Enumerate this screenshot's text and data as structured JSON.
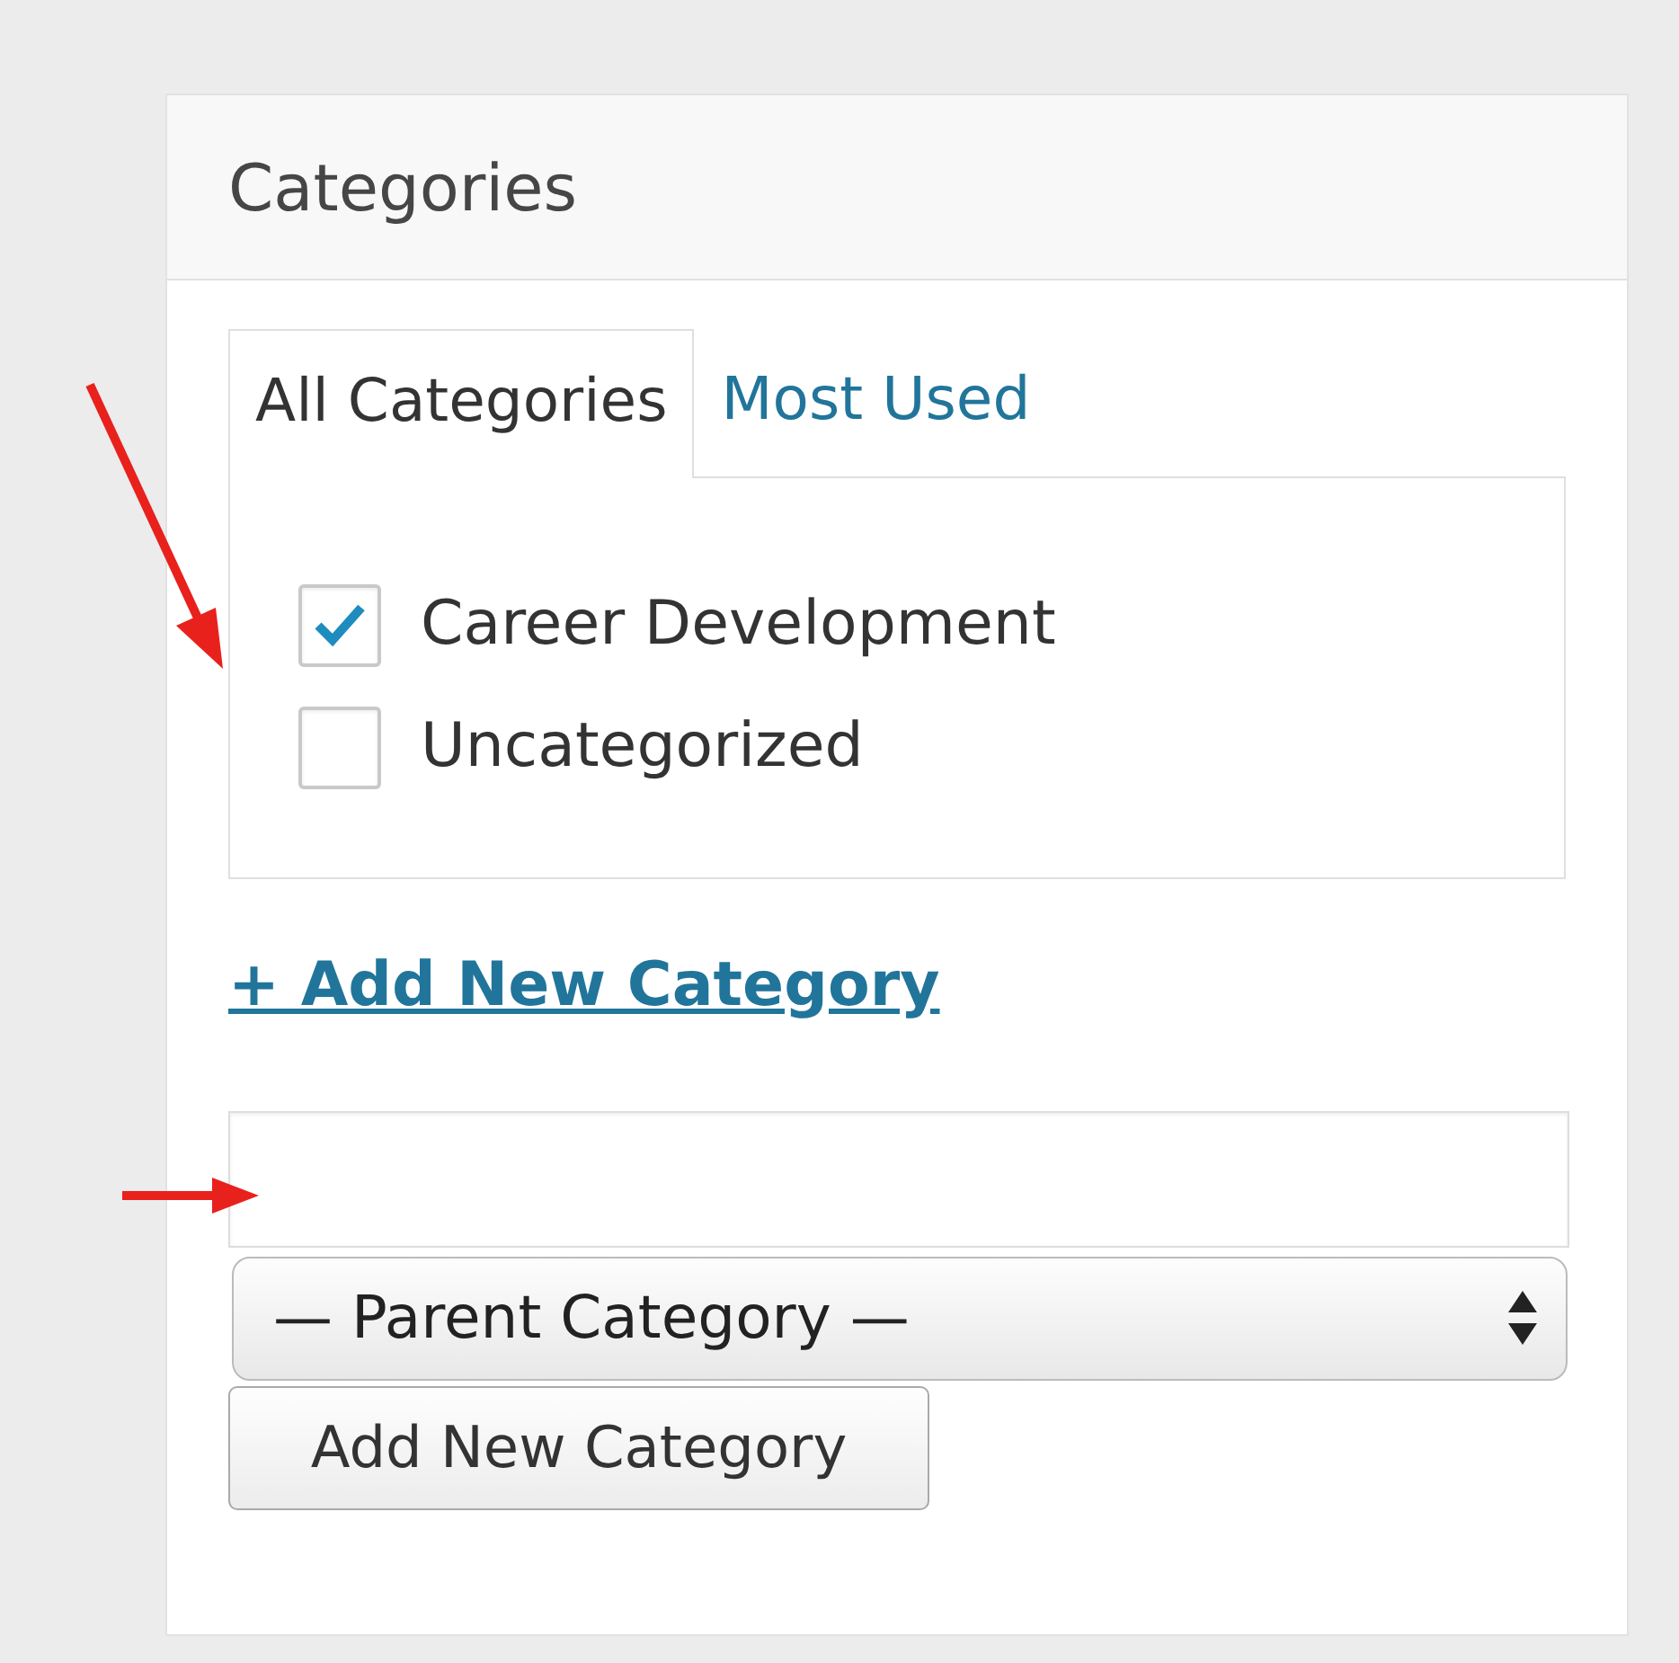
{
  "panel": {
    "title": "Categories"
  },
  "tabs": [
    {
      "label": "All Categories",
      "selected": true
    },
    {
      "label": "Most Used",
      "selected": false
    }
  ],
  "categories": [
    {
      "label": "Career Development",
      "checked": true
    },
    {
      "label": "Uncategorized",
      "checked": false
    }
  ],
  "add_link": "+ Add New Category",
  "parent_select": {
    "value": "— Parent Category —"
  },
  "submit_button": "Add New Category"
}
